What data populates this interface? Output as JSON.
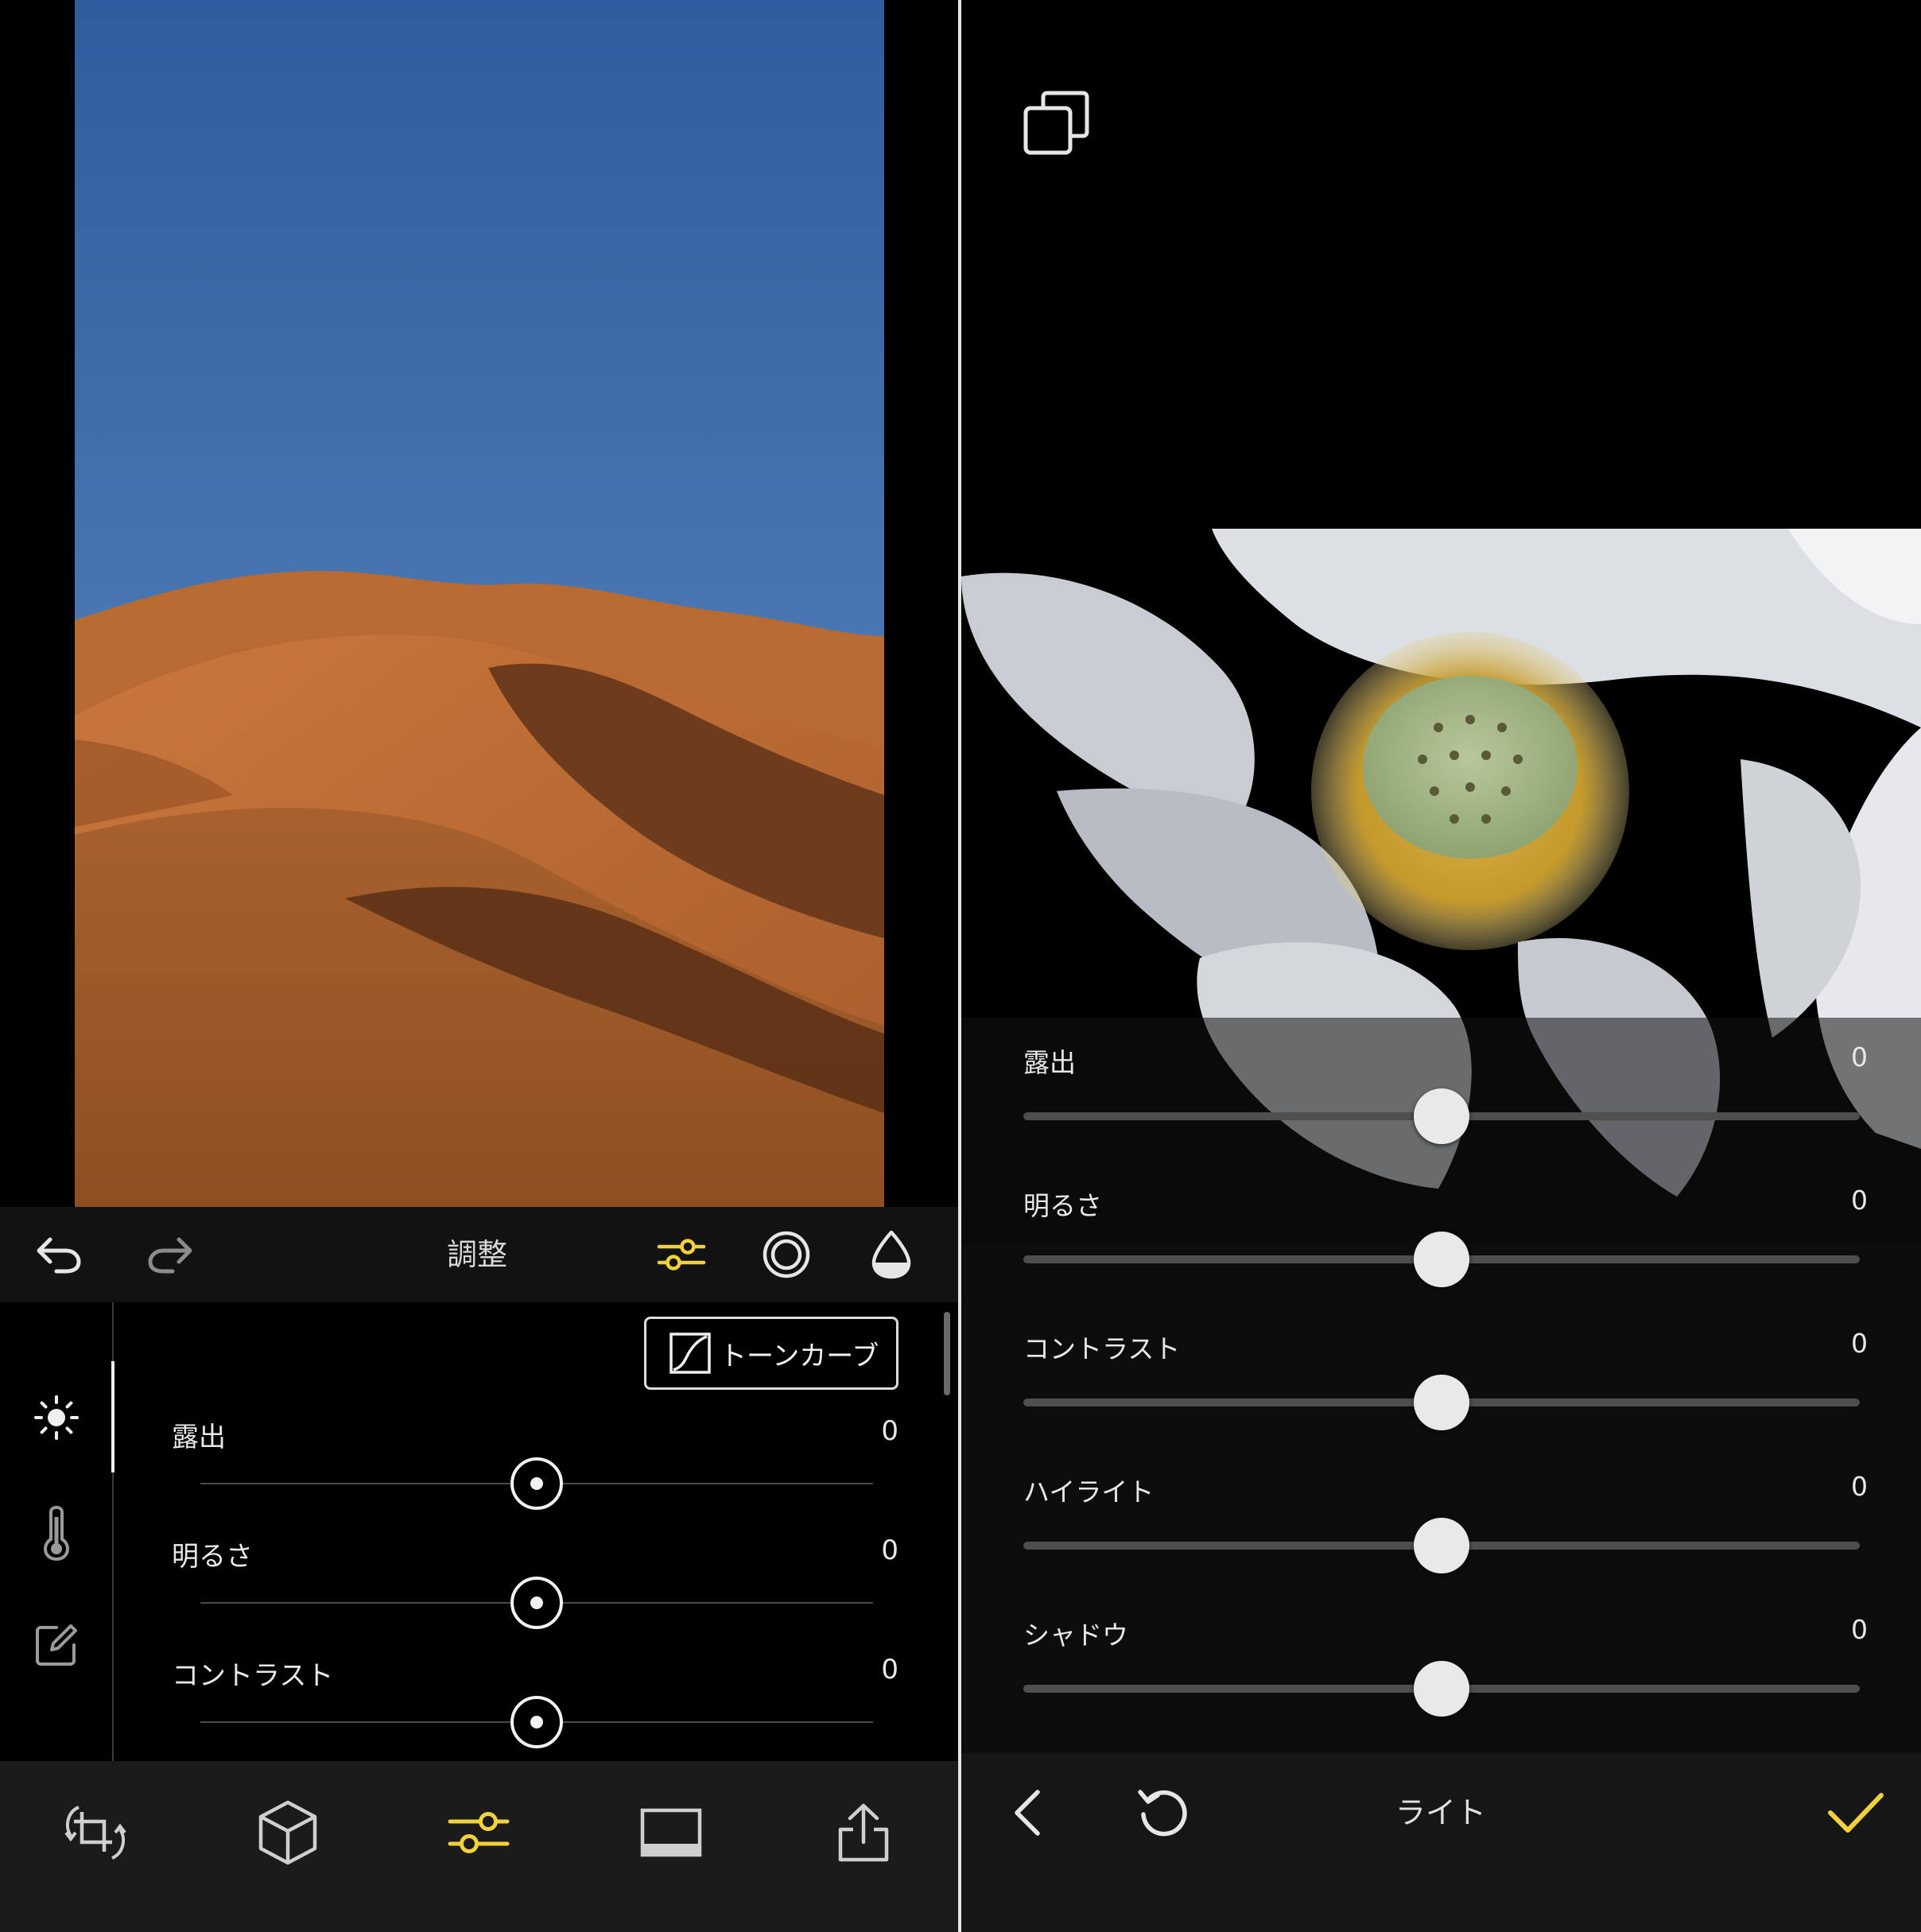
{
  "colors": {
    "accent": "#f2d23a",
    "icon": "#e6e6e6",
    "muted": "#9a9a9a"
  },
  "left": {
    "toolbar": {
      "title": "調整",
      "icons": [
        "undo-icon",
        "redo-icon",
        "sliders-icon",
        "filter-rings-icon",
        "color-drop-icon"
      ]
    },
    "rail": {
      "icons": [
        "light-sun-icon",
        "temperature-icon",
        "edit-icon"
      ]
    },
    "tone_curve_label": "トーンカーブ",
    "sliders": [
      {
        "label": "露出",
        "value": "0",
        "position": 0.5
      },
      {
        "label": "明るさ",
        "value": "0",
        "position": 0.5
      },
      {
        "label": "コントラスト",
        "value": "0",
        "position": 0.5
      }
    ],
    "bottom_bar": {
      "icons": [
        "crop-rotate-icon",
        "3d-cube-icon",
        "adjust-sliders-icon",
        "frame-icon",
        "share-icon"
      ]
    }
  },
  "right": {
    "sliders": [
      {
        "label": "露出",
        "value": "0",
        "position": 0.5
      },
      {
        "label": "明るさ",
        "value": "0",
        "position": 0.5
      },
      {
        "label": "コントラスト",
        "value": "0",
        "position": 0.5
      },
      {
        "label": "ハイライト",
        "value": "0",
        "position": 0.5
      },
      {
        "label": "シャドウ",
        "value": "0",
        "position": 0.5
      }
    ],
    "bottom": {
      "title": "ライト"
    }
  }
}
